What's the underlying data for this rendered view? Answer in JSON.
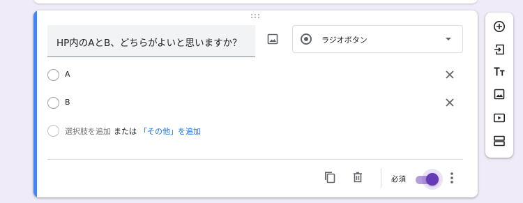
{
  "question": {
    "title": "HP内のAとB、どちらがよいと思いますか？",
    "type_label": "ラジオボタン",
    "options": [
      {
        "label": "A"
      },
      {
        "label": "B"
      }
    ],
    "add_option_label": "選択肢を追加",
    "or_label": "または",
    "add_other_label": "「その他」を追加"
  },
  "footer": {
    "required_label": "必須",
    "required_enabled": true
  },
  "colors": {
    "accent": "#4285f4",
    "toggle": "#673ab7",
    "link": "#1a73e8",
    "background": "#f0ebf8"
  },
  "icons": {
    "question": [
      "drag-handle-icon",
      "image-icon",
      "radio-button-icon",
      "dropdown-caret-icon"
    ],
    "option": [
      "radio-empty-icon",
      "close-icon"
    ],
    "footer": [
      "duplicate-icon",
      "trash-icon",
      "more-vert-icon"
    ],
    "toolbar": [
      "add-circle-icon",
      "import-icon",
      "title-icon",
      "image-icon",
      "video-icon",
      "section-icon"
    ]
  }
}
